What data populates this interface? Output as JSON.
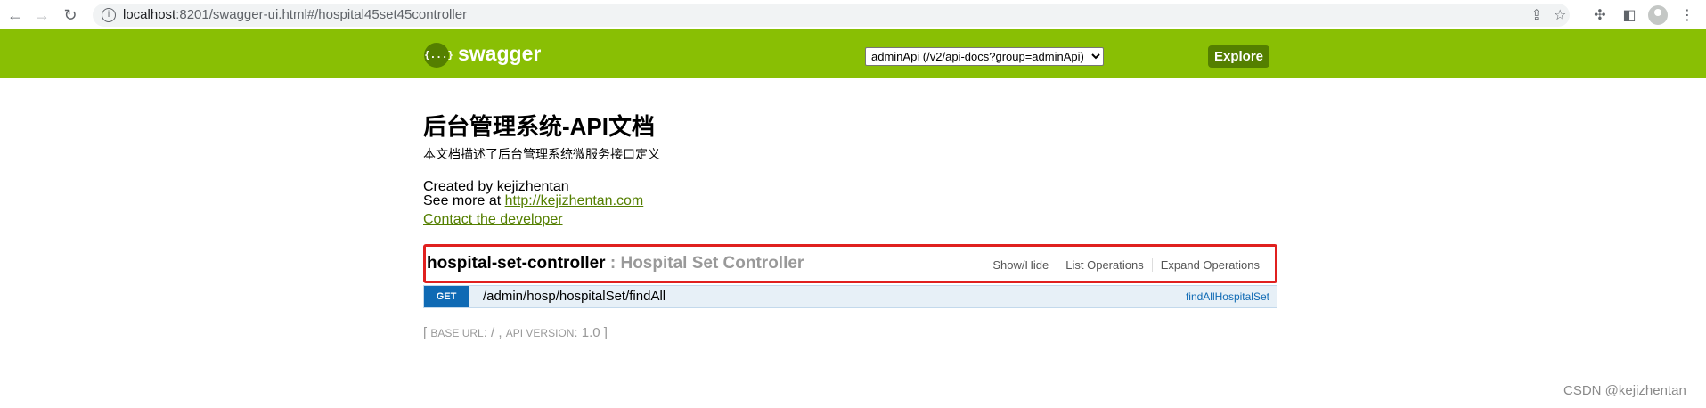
{
  "browser": {
    "url_host": "localhost",
    "url_rest": ":8201/swagger-ui.html#/hospital45set45controller",
    "icons": [
      "back-icon",
      "forward-icon",
      "reload-icon",
      "info-icon",
      "share-icon",
      "star-icon",
      "extensions-icon",
      "sidepanel-icon",
      "profile-icon",
      "menu-icon"
    ]
  },
  "header": {
    "logo_mark": "{...}",
    "logo_text": "swagger",
    "api_select": "adminApi (/v2/api-docs?group=adminApi)",
    "explore_label": "Explore",
    "bg_color": "#89bf04"
  },
  "info": {
    "title": "后台管理系统-API文档",
    "description": "本文档描述了后台管理系统微服务接口定义",
    "created_by": "Created by kejizhentan",
    "see_more_prefix": "See more at ",
    "see_more_link": "http://kejizhentan.com",
    "contact_label": "Contact the developer"
  },
  "resource": {
    "name": "hospital-set-controller",
    "separator": " : ",
    "description": "Hospital Set Controller",
    "actions": [
      "Show/Hide",
      "List Operations",
      "Expand Operations"
    ],
    "highlight_color": "#e0201f"
  },
  "operation": {
    "method": "GET",
    "path": "/admin/hosp/hospitalSet/findAll",
    "nickname": "findAllHospitalSet"
  },
  "footer": {
    "open": "[ ",
    "base_url_label": "BASE URL",
    "base_url_value": ": / , ",
    "api_version_label": "API VERSION",
    "api_version_value": ": 1.0 ",
    "close": "]"
  },
  "watermark": "CSDN @kejizhentan"
}
